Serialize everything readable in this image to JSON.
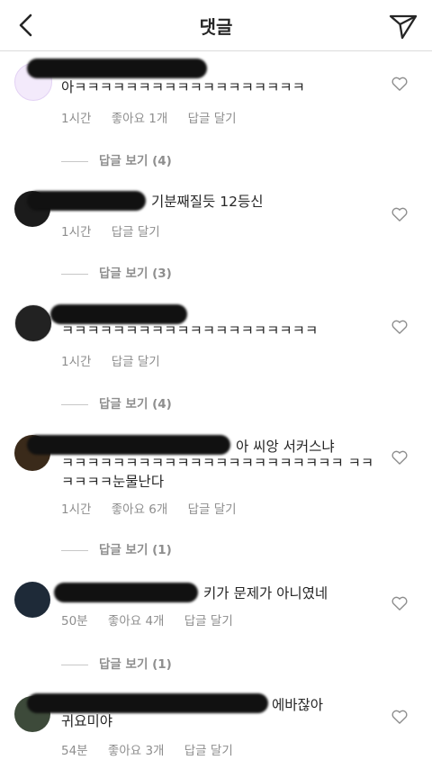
{
  "header": {
    "title": "댓글"
  },
  "comments": [
    {
      "text": "아ㅋㅋㅋㅋㅋㅋㅋㅋㅋㅋㅋㅋㅋㅋㅋㅋㅋㅋ",
      "time": "1시간",
      "likes": "좋아요 1개",
      "reply": "답글 달기",
      "view_replies": "답글 보기 (4)"
    },
    {
      "text": "기분째질듯 12등신",
      "time": "1시간",
      "reply": "답글 달기",
      "view_replies": "답글 보기 (3)"
    },
    {
      "text": "ㅋㅋㅋㅋㅋㅋㅋㅋㅋㅋㅋㅋㅋㅋㅋㅋㅋㅋㅋㅋ",
      "time": "1시간",
      "reply": "답글 달기",
      "view_replies": "답글 보기 (4)"
    },
    {
      "text_inline": "아 씨앙 서커스냐",
      "text": "ㅋㅋㅋㅋㅋㅋㅋㅋㅋㅋㅋㅋㅋㅋㅋㅋㅋㅋㅋㅋㅋㅋ ㅋㅋㅋㅋㅋㅋ눈물난다",
      "time": "1시간",
      "likes": "좋아요 6개",
      "reply": "답글 달기",
      "view_replies": "답글 보기 (1)"
    },
    {
      "text_inline": "키가 문제가 아니였네",
      "time": "50분",
      "likes": "좋아요 4개",
      "reply": "답글 달기",
      "view_replies": "답글 보기 (1)"
    },
    {
      "text_inline": "에바잖아",
      "text": "귀요미야",
      "time": "54분",
      "likes": "좋아요 3개",
      "reply": "답글 달기"
    }
  ]
}
